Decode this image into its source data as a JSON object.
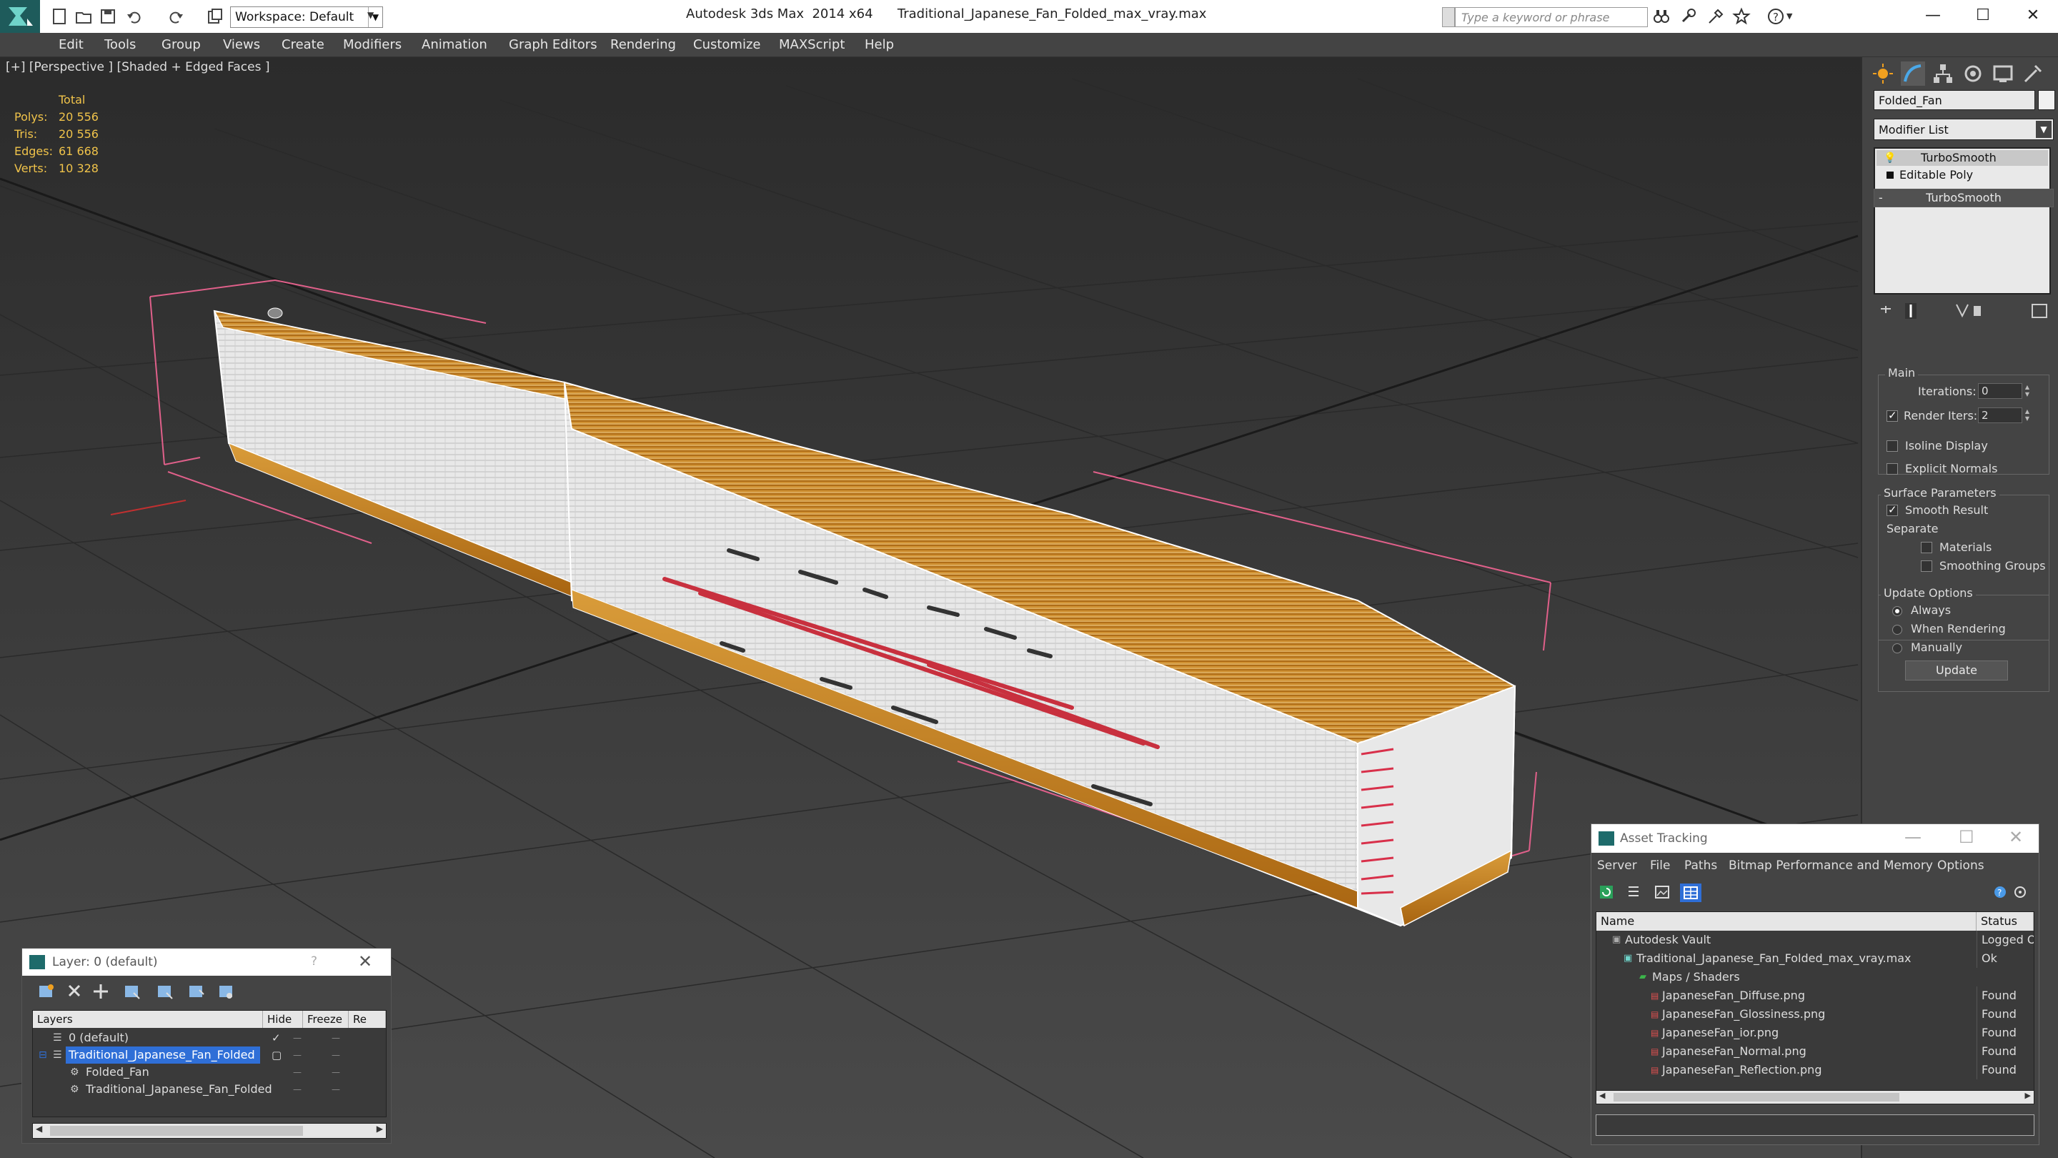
{
  "titlebar": {
    "app_title": "Autodesk 3ds Max  2014 x64",
    "file_name": "Traditional_Japanese_Fan_Folded_max_vray.max",
    "workspace": "Workspace: Default",
    "search_placeholder": "Type a keyword or phrase"
  },
  "menu": [
    "Edit",
    "Tools",
    "Group",
    "Views",
    "Create",
    "Modifiers",
    "Animation",
    "Graph Editors",
    "Rendering",
    "Customize",
    "MAXScript",
    "Help"
  ],
  "viewport": {
    "label": "[+] [Perspective ] [Shaded + Edged Faces ]",
    "stats": {
      "header": "Total",
      "rows": [
        {
          "key": "Polys:",
          "value": "20 556"
        },
        {
          "key": "Tris:",
          "value": "20 556"
        },
        {
          "key": "Edges:",
          "value": "61 668"
        },
        {
          "key": "Verts:",
          "value": "10 328"
        }
      ]
    }
  },
  "command_panel": {
    "object_name": "Folded_Fan",
    "modifier_list": "Modifier List",
    "stack": [
      "TurboSmooth",
      "Editable Poly"
    ],
    "rollout_title": "TurboSmooth",
    "main_group": "Main",
    "iterations_label": "Iterations:",
    "iterations_value": "0",
    "render_iters_label": "Render Iters:",
    "render_iters_value": "2",
    "render_iters_checked": true,
    "isoline_label": "Isoline Display",
    "explicit_normals_label": "Explicit Normals",
    "surface_group": "Surface Parameters",
    "smooth_result_label": "Smooth Result",
    "separate_label": "Separate",
    "materials_label": "Materials",
    "smoothing_groups_label": "Smoothing Groups",
    "update_group": "Update Options",
    "update_options": [
      "Always",
      "When Rendering",
      "Manually"
    ],
    "update_selected": "Always",
    "update_button": "Update"
  },
  "layer_window": {
    "title": "Layer: 0 (default)",
    "help": "?",
    "columns": [
      "Layers",
      "Hide",
      "Freeze",
      "Re"
    ],
    "rows": [
      {
        "name": "0 (default)",
        "indent": 0
      },
      {
        "name": "Traditional_Japanese_Fan_Folded",
        "indent": 0,
        "selected": true
      },
      {
        "name": "Folded_Fan",
        "indent": 1
      },
      {
        "name": "Traditional_Japanese_Fan_Folded",
        "indent": 1
      }
    ]
  },
  "asset_window": {
    "title": "Asset Tracking",
    "menu": [
      "Server",
      "File",
      "Paths",
      "Bitmap Performance and Memory",
      "Options"
    ],
    "columns": [
      "Name",
      "Status"
    ],
    "rows": [
      {
        "name": "Autodesk Vault",
        "status": "Logged O",
        "indent": 0
      },
      {
        "name": "Traditional_Japanese_Fan_Folded_max_vray.max",
        "status": "Ok",
        "indent": 1
      },
      {
        "name": "Maps / Shaders",
        "status": "",
        "indent": 2
      },
      {
        "name": "JapaneseFan_Diffuse.png",
        "status": "Found",
        "indent": 3
      },
      {
        "name": "JapaneseFan_Glossiness.png",
        "status": "Found",
        "indent": 3
      },
      {
        "name": "JapaneseFan_ior.png",
        "status": "Found",
        "indent": 3
      },
      {
        "name": "JapaneseFan_Normal.png",
        "status": "Found",
        "indent": 3
      },
      {
        "name": "JapaneseFan_Reflection.png",
        "status": "Found",
        "indent": 3
      }
    ]
  },
  "colors": {
    "stats_yellow": "#f0c34a",
    "wood_orange": "#c9821a",
    "selection_blue": "#2f6fd7",
    "bbox_pink": "#e0608a"
  }
}
